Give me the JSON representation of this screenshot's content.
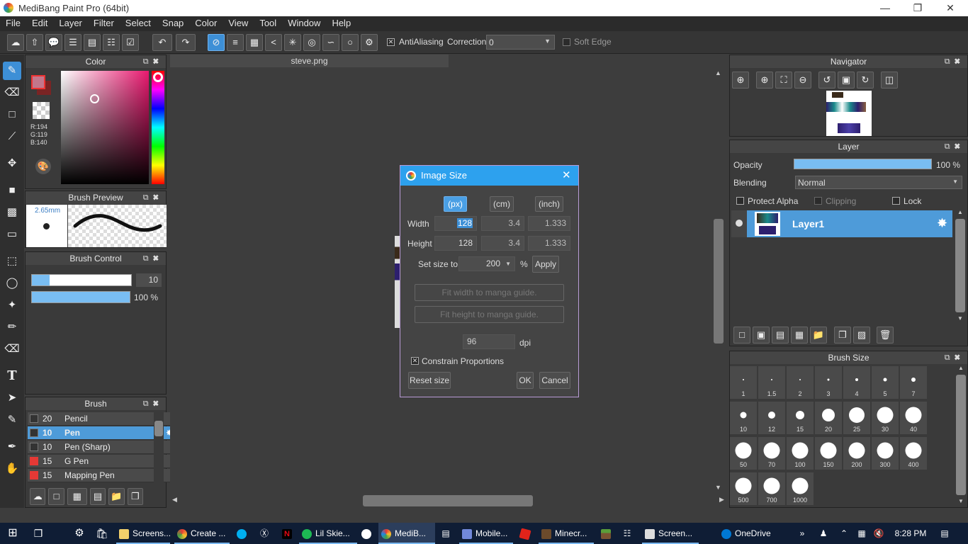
{
  "window": {
    "title": "MediBang Paint Pro (64bit)"
  },
  "menu": [
    "File",
    "Edit",
    "Layer",
    "Filter",
    "Select",
    "Snap",
    "Color",
    "View",
    "Tool",
    "Window",
    "Help"
  ],
  "toolbar": {
    "antialiasing_label": "AntiAliasing",
    "correction_label": "Correction",
    "correction_value": "0",
    "soft_edge_label": "Soft Edge"
  },
  "color_panel": {
    "title": "Color",
    "r": "R:194",
    "g": "G:119",
    "b": "B:140",
    "foreground": "#c2778c",
    "background": "#7a2424"
  },
  "brush_preview": {
    "title": "Brush Preview",
    "size": "2.65mm"
  },
  "brush_control": {
    "title": "Brush Control",
    "size_value": "10",
    "opacity_value": "100 %"
  },
  "brush_panel": {
    "title": "Brush",
    "items": [
      {
        "size": "20",
        "name": "Pencil",
        "color": "#333333"
      },
      {
        "size": "10",
        "name": "Pen",
        "color": "#333333"
      },
      {
        "size": "10",
        "name": "Pen (Sharp)",
        "color": "#333333"
      },
      {
        "size": "15",
        "name": "G Pen",
        "color": "#e53935"
      },
      {
        "size": "15",
        "name": "Mapping Pen",
        "color": "#e53935"
      }
    ]
  },
  "document_tab": "steve.png",
  "dialog": {
    "title": "Image Size",
    "unit_px": "(px)",
    "unit_cm": "(cm)",
    "unit_inch": "(inch)",
    "width_label": "Width",
    "width_px": "128",
    "width_cm": "3.4",
    "width_inch": "1.333",
    "height_label": "Height",
    "height_px": "128",
    "height_cm": "3.4",
    "height_inch": "1.333",
    "set_size_label": "Set size to",
    "set_size_value": "200",
    "percent": "%",
    "apply": "Apply",
    "fit_width": "Fit width to manga guide.",
    "fit_height": "Fit height to manga guide.",
    "dpi_value": "96",
    "dpi_label": "dpi",
    "constrain_label": "Constrain Proportions",
    "reset": "Reset size",
    "ok": "OK",
    "cancel": "Cancel"
  },
  "navigator": {
    "title": "Navigator"
  },
  "layer_panel": {
    "title": "Layer",
    "opacity_label": "Opacity",
    "opacity_value": "100 %",
    "blending_label": "Blending",
    "blending_value": "Normal",
    "protect_alpha": "Protect Alpha",
    "clipping": "Clipping",
    "lock": "Lock",
    "layer_name": "Layer1"
  },
  "brush_size_panel": {
    "title": "Brush Size",
    "sizes": [
      "1",
      "1.5",
      "2",
      "3",
      "4",
      "5",
      "7",
      "10",
      "12",
      "15",
      "20",
      "25",
      "30",
      "40",
      "50",
      "70",
      "100",
      "150",
      "200",
      "300",
      "400",
      "500",
      "700",
      "1000"
    ]
  },
  "taskbar": {
    "items": [
      "Screens...",
      "Create ...",
      "Lil Skie...",
      "MediB...",
      "Mobile...",
      "Minecr...",
      "Screen...",
      "OneDrive"
    ],
    "time": "8:28 PM"
  }
}
